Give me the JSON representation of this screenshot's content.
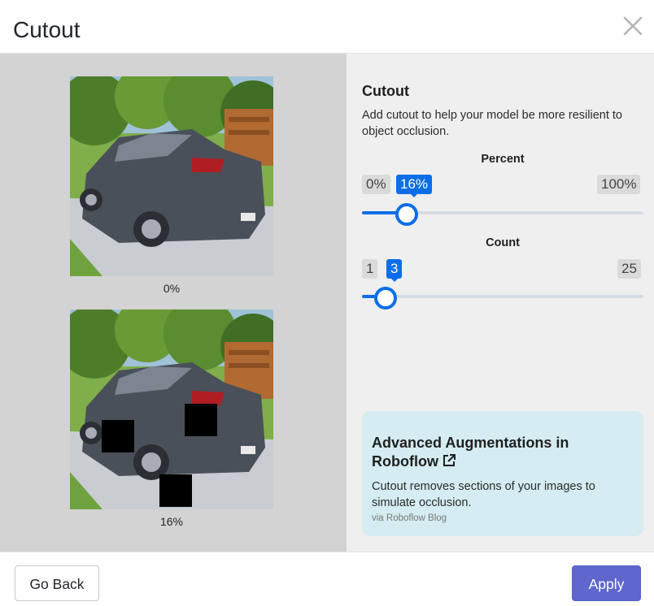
{
  "dialog": {
    "title": "Cutout"
  },
  "previews": [
    {
      "caption": "0%",
      "cutout_boxes": 0
    },
    {
      "caption": "16%",
      "cutout_boxes": 3
    }
  ],
  "option": {
    "title": "Cutout",
    "description": "Add cutout to help your model be more resilient to object occlusion."
  },
  "percent_slider": {
    "label": "Percent",
    "min_label": "0%",
    "value_label": "16%",
    "max_label": "100%",
    "min": 0,
    "max": 100,
    "value": 16
  },
  "count_slider": {
    "label": "Count",
    "min_label": "1",
    "value_label": "3",
    "max_label": "25",
    "min": 1,
    "max": 25,
    "value": 3
  },
  "info_card": {
    "title": "Advanced Augmentations in Roboflow",
    "text": "Cutout removes sections of your images to simulate occlusion.",
    "via": "via Roboflow Blog"
  },
  "footer": {
    "back_label": "Go Back",
    "apply_label": "Apply"
  },
  "colors": {
    "accent": "#0b6ee8",
    "apply": "#5f67cd",
    "card": "#d4ecf2"
  }
}
